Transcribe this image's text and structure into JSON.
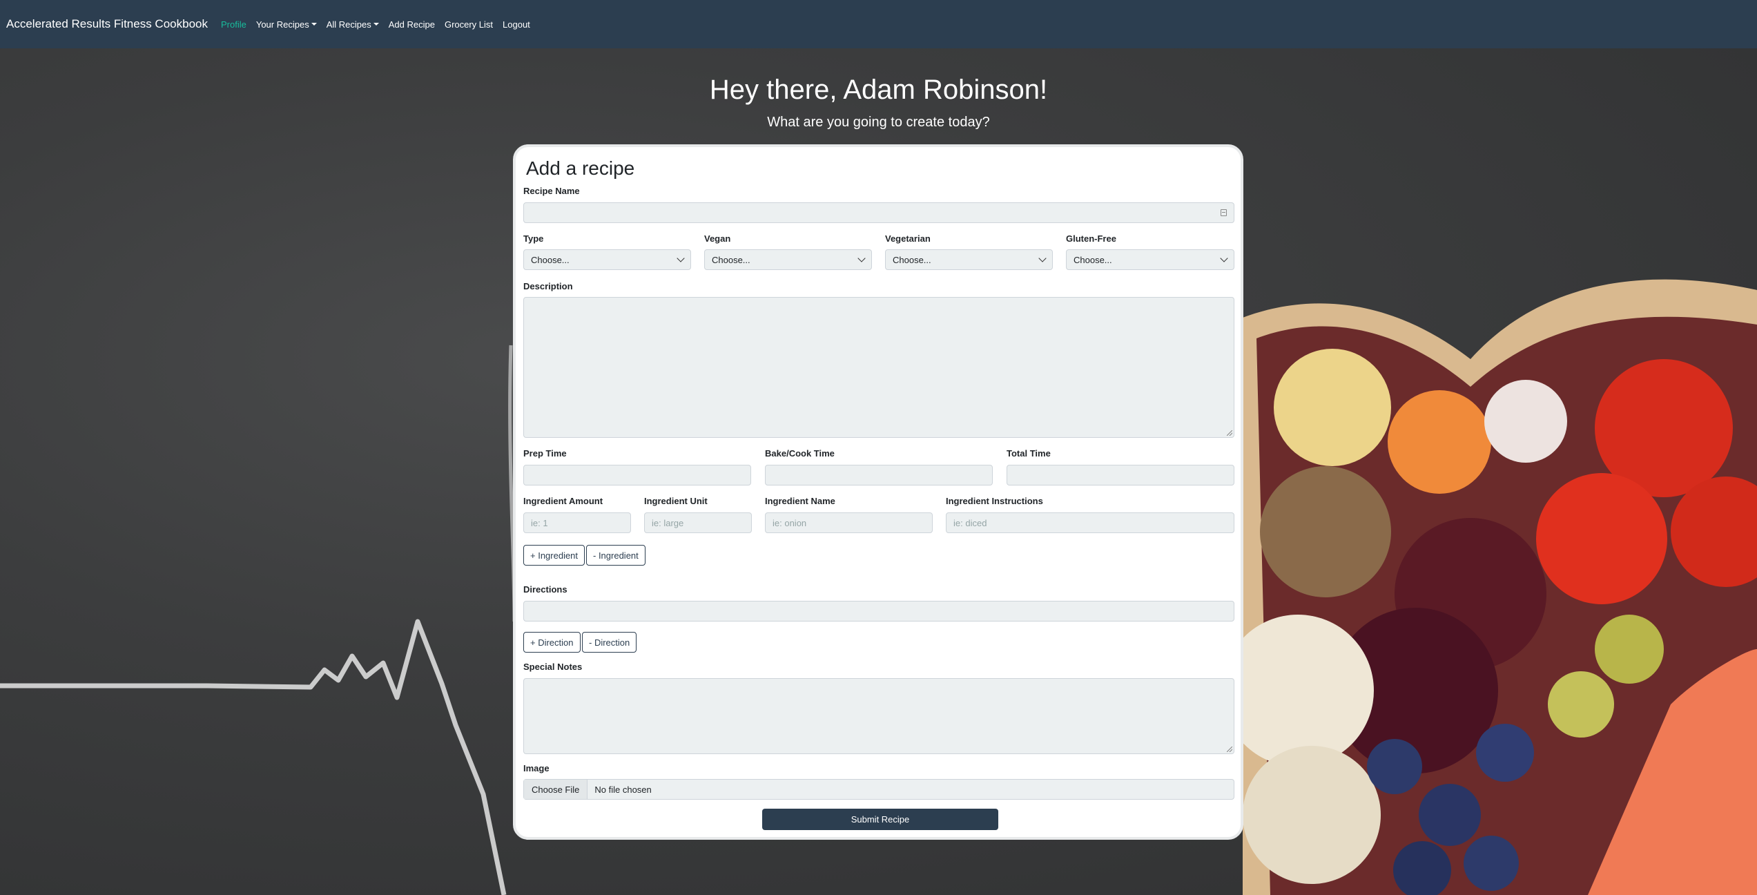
{
  "navbar": {
    "brand": "Accelerated Results Fitness Cookbook",
    "items": [
      {
        "label": "Profile"
      },
      {
        "label": "Your Recipes"
      },
      {
        "label": "All Recipes"
      },
      {
        "label": "Add Recipe"
      },
      {
        "label": "Grocery List"
      },
      {
        "label": "Logout"
      }
    ]
  },
  "header": {
    "greeting": "Hey there, Adam Robinson!",
    "subtitle": "What are you going to create today?"
  },
  "form": {
    "title": "Add a recipe",
    "recipe_name_label": "Recipe Name",
    "type_label": "Type",
    "vegan_label": "Vegan",
    "vegetarian_label": "Vegetarian",
    "gluten_free_label": "Gluten-Free",
    "choose": "Choose...",
    "description_label": "Description",
    "prep_time_label": "Prep Time",
    "cook_time_label": "Bake/Cook Time",
    "total_time_label": "Total Time",
    "ingredient_amount_label": "Ingredient Amount",
    "ingredient_unit_label": "Ingredient Unit",
    "ingredient_name_label": "Ingredient Name",
    "ingredient_instructions_label": "Ingredient Instructions",
    "ingredient_amount_placeholder": "ie: 1",
    "ingredient_unit_placeholder": "ie: large",
    "ingredient_name_placeholder": "ie: onion",
    "ingredient_instructions_placeholder": "ie: diced",
    "add_ingredient": "+ Ingredient",
    "remove_ingredient": "- Ingredient",
    "directions_label": "Directions",
    "add_direction": "+ Direction",
    "remove_direction": "- Direction",
    "special_notes_label": "Special Notes",
    "image_label": "Image",
    "choose_file": "Choose File",
    "no_file": "No file chosen",
    "submit": "Submit Recipe"
  },
  "colors": {
    "navbar": "#2c3e50",
    "active_link": "#18bc9c",
    "input_bg": "#ecf0f1"
  }
}
